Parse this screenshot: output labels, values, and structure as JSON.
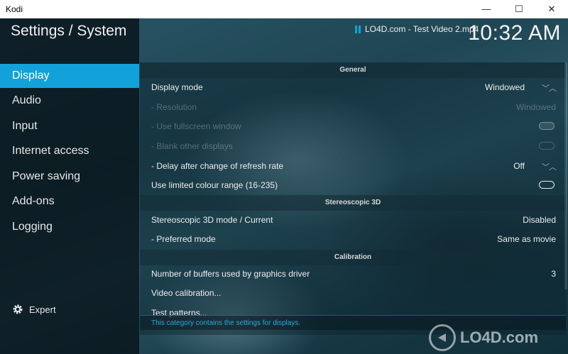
{
  "window": {
    "title": "Kodi",
    "minimize_glyph": "—",
    "maximize_glyph": "☐",
    "close_glyph": "✕"
  },
  "header": {
    "title": "Settings / System",
    "now_playing": "LO4D.com - Test Video 2.mp4",
    "clock": "10:32 AM"
  },
  "sidebar": {
    "items": [
      {
        "label": "Display",
        "active": true
      },
      {
        "label": "Audio"
      },
      {
        "label": "Input"
      },
      {
        "label": "Internet access"
      },
      {
        "label": "Power saving"
      },
      {
        "label": "Add-ons"
      },
      {
        "label": "Logging"
      }
    ],
    "expert_label": "Expert"
  },
  "general": {
    "title": "General",
    "display_mode": {
      "label": "Display mode",
      "value": "Windowed"
    },
    "resolution": {
      "label": "- Resolution",
      "value": "Windowed"
    },
    "fullscreen_window": {
      "label": "- Use fullscreen window"
    },
    "blank_displays": {
      "label": "- Blank other displays"
    },
    "delay_refresh": {
      "label": "- Delay after change of refresh rate",
      "value": "Off"
    },
    "limited_colour": {
      "label": "Use limited colour range (16-235)"
    }
  },
  "stereo": {
    "title": "Stereoscopic 3D",
    "mode": {
      "label": "Stereoscopic 3D mode / Current",
      "value": "Disabled"
    },
    "preferred": {
      "label": "- Preferred mode",
      "value": "Same as movie"
    }
  },
  "calibration": {
    "title": "Calibration",
    "buffers": {
      "label": "Number of buffers used by graphics driver",
      "value": "3"
    },
    "video_calibration": {
      "label": "Video calibration..."
    },
    "test_patterns": {
      "label": "Test patterns..."
    }
  },
  "footer": {
    "description": "This category contains the settings for displays."
  },
  "watermark": {
    "text": "LO4D.com"
  },
  "colors": {
    "accent": "#12a2d9",
    "sidebar": "#08141a",
    "text": "#ededed"
  }
}
